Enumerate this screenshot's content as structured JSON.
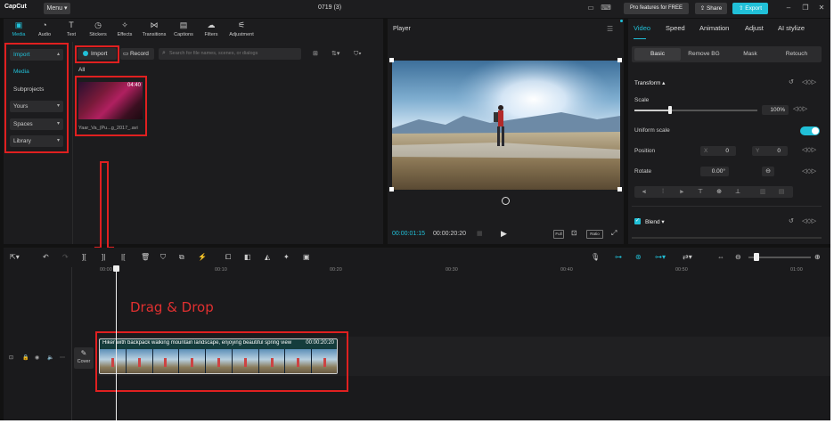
{
  "app": {
    "logo": "CapCut",
    "menu": "Menu",
    "project_title": "0719 (3)",
    "pro_button": "Pro features for FREE",
    "share": "Share",
    "export": "Export",
    "window_controls": [
      "minimize-icon",
      "maximize-icon",
      "close-icon"
    ],
    "accent": "#21c0d8"
  },
  "toolbar": {
    "tabs": [
      {
        "label": "Media",
        "icon": "media-icon",
        "active": true
      },
      {
        "label": "Audio",
        "icon": "audio-icon"
      },
      {
        "label": "Text",
        "icon": "text-icon"
      },
      {
        "label": "Stickers",
        "icon": "stickers-icon"
      },
      {
        "label": "Effects",
        "icon": "effects-icon"
      },
      {
        "label": "Transitions",
        "icon": "transitions-icon"
      },
      {
        "label": "Captions",
        "icon": "captions-icon"
      },
      {
        "label": "Filters",
        "icon": "filters-icon"
      },
      {
        "label": "Adjustment",
        "icon": "adjustment-icon"
      }
    ]
  },
  "sidebar": {
    "items": [
      {
        "label": "Import",
        "chevron": "▴",
        "active": true
      },
      {
        "label": "Media",
        "active": true
      },
      {
        "label": "Subprojects"
      },
      {
        "label": "Yours",
        "chevron": "▾"
      },
      {
        "label": "Spaces",
        "chevron": "▾"
      },
      {
        "label": "Library",
        "chevron": "▾"
      }
    ]
  },
  "media": {
    "import_label": "Import",
    "record_label": "Record",
    "search_placeholder": "Search for file names, scenes, or dialogs",
    "filter_all": "All",
    "clip": {
      "duration": "04:40",
      "name": "Yaar_Va_(Pu...g_2017_.avi"
    }
  },
  "player": {
    "title": "Player",
    "current_time": "00:00:01:15",
    "total_time": "00:00:20:20",
    "tools": [
      "Full",
      "Ratio"
    ]
  },
  "properties": {
    "tabs": [
      "Video",
      "Speed",
      "Animation",
      "Adjust",
      "AI stylize"
    ],
    "subtabs": [
      "Basic",
      "Remove BG",
      "Mask",
      "Retouch"
    ],
    "transform": "Transform",
    "scale_label": "Scale",
    "scale_value": "100%",
    "scale_level": 0.1,
    "uniform_scale": "Uniform scale",
    "position_label": "Position",
    "pos_x_label": "X",
    "pos_x": "0",
    "pos_y_label": "Y",
    "pos_y": "0",
    "rotate_label": "Rotate",
    "rotate_value": "0.00°",
    "blend_label": "Blend"
  },
  "timeline": {
    "ruler": [
      "00:00",
      "00:10",
      "00:20",
      "00:30",
      "00:40",
      "00:50",
      "01:00"
    ],
    "clip_title": "Hiker with backpack walking mountain landscape, enjoying beautiful spring view",
    "clip_duration": "00:00:20:20",
    "cover_label": "Cover",
    "annotation": "Drag & Drop"
  }
}
